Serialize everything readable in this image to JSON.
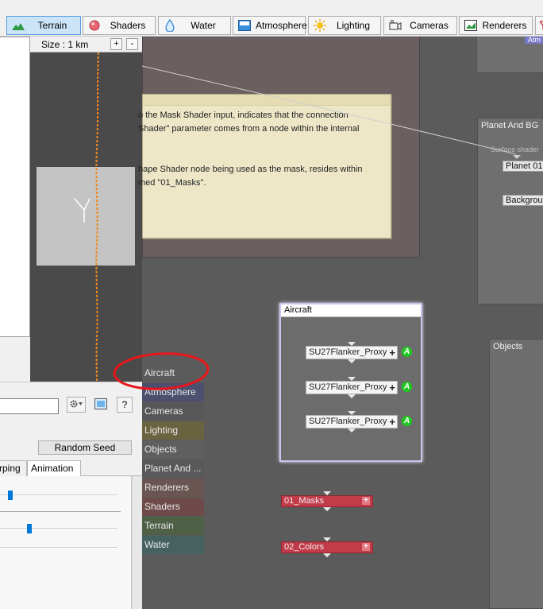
{
  "toolbar": {
    "items": [
      {
        "label": "Terrain",
        "icon": "terrain-icon",
        "active": true
      },
      {
        "label": "Shaders",
        "icon": "shaders-icon",
        "active": false
      },
      {
        "label": "Water",
        "icon": "water-drop-icon",
        "active": false
      },
      {
        "label": "Atmosphere",
        "icon": "atmosphere-icon",
        "active": false
      },
      {
        "label": "Lighting",
        "icon": "sun-icon",
        "active": false
      },
      {
        "label": "Cameras",
        "icon": "camera-icon",
        "active": false
      },
      {
        "label": "Renderers",
        "icon": "renderer-icon",
        "active": false
      }
    ]
  },
  "map": {
    "size_label": "Size : 1 km",
    "zoom_in": "+",
    "zoom_out": "-"
  },
  "settings": {
    "random_seed_label": "Random Seed",
    "help_label": "?",
    "tabs": [
      {
        "label": "rping",
        "active": false
      },
      {
        "label": "Animation",
        "active": true
      }
    ],
    "sliders": [
      0.07,
      0.23
    ]
  },
  "categories": [
    {
      "label": "Aircraft",
      "color": "#5b5b5b"
    },
    {
      "label": "Atmosphere",
      "color": "#4c4f6d"
    },
    {
      "label": "Cameras",
      "color": "#575757"
    },
    {
      "label": "Lighting",
      "color": "#6a6340"
    },
    {
      "label": "Objects",
      "color": "#5f5f5f"
    },
    {
      "label": "Planet And ...",
      "color": "#595959"
    },
    {
      "label": "Renderers",
      "color": "#6a5552"
    },
    {
      "label": "Shaders",
      "color": "#6e4a4a"
    },
    {
      "label": "Terrain",
      "color": "#4e6046"
    },
    {
      "label": "Water",
      "color": "#466260"
    }
  ],
  "note": {
    "lines": [
      "o the Mask Shader input, indicates that the connection",
      " Shader\" parameter comes from a node within the internal",
      "",
      "hape Shader node being used as the mask, resides within",
      "med \"01_Masks\"."
    ]
  },
  "graph": {
    "planet_frame_title": "Planet And BG",
    "surface_shader_label": "Surface shader",
    "planet_node": "Planet 01",
    "background_node": "Backgroun",
    "atmos_node": "Atm",
    "objects_frame_title": "Objects",
    "aircraft_frame_title": "Aircraft",
    "proxies": [
      "SU27Flanker_Proxy",
      "SU27Flanker_Proxy",
      "SU27Flanker_Proxy"
    ],
    "anim_badge": "A",
    "plus_glyph": "+",
    "mask_node": "01_Masks",
    "color_node": "02_Colors"
  },
  "colors": {
    "graph_bg": "#5b5b5b",
    "highlight_circle": "#e8161a",
    "terrain_path": "#f08a1c",
    "red_node": "#c23b49"
  }
}
